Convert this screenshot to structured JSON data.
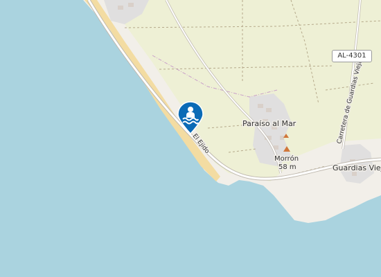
{
  "map": {
    "colors": {
      "sea": "#aad3df",
      "land": "#f2efe9",
      "farmland": "#eef0d5",
      "beach": "#f3dca2",
      "residential": "#e0dfdf",
      "road": "#ffffff",
      "marker": "#0b6bb6"
    },
    "labels": {
      "town1": "Paraíso al Mar",
      "town2": "Guardias Viejas",
      "peak_name": "Morrón",
      "peak_elevation": "58 m",
      "coast_road": "El Ejido",
      "inland_road": "Carretera de Guardias Viejas",
      "road_ref": "AL-4301"
    },
    "marker": {
      "icon": "swimming-icon",
      "type": "beach/swimming"
    },
    "peak_icon": "peak-triangle-icon"
  }
}
